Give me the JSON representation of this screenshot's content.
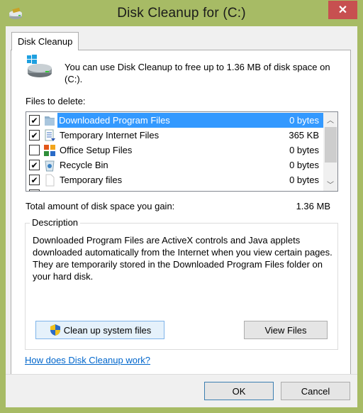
{
  "window": {
    "title": "Disk Cleanup for  (C:)",
    "close_icon": "close-icon",
    "app_icon": "disk-cleanup-icon"
  },
  "tabs": [
    {
      "label": "Disk Cleanup",
      "active": true
    }
  ],
  "intro_text": "You can use Disk Cleanup to free up to 1.36 MB of disk space on (C:).",
  "files_to_delete_label": "Files to delete:",
  "files": [
    {
      "name": "Downloaded Program Files",
      "size": "0 bytes",
      "checked": true,
      "selected": true,
      "icon": "folder-icon"
    },
    {
      "name": "Temporary Internet Files",
      "size": "365 KB",
      "checked": true,
      "selected": false,
      "icon": "document-icon"
    },
    {
      "name": "Office Setup Files",
      "size": "0 bytes",
      "checked": false,
      "selected": false,
      "icon": "office-icon"
    },
    {
      "name": "Recycle Bin",
      "size": "0 bytes",
      "checked": true,
      "selected": false,
      "icon": "recycle-bin-icon"
    },
    {
      "name": "Temporary files",
      "size": "0 bytes",
      "checked": true,
      "selected": false,
      "icon": "file-icon"
    }
  ],
  "total": {
    "label": "Total amount of disk space you gain:",
    "value": "1.36 MB"
  },
  "description": {
    "legend": "Description",
    "text": "Downloaded Program Files are ActiveX controls and Java applets downloaded automatically from the Internet when you view certain pages. They are temporarily stored in the Downloaded Program Files folder on your hard disk."
  },
  "buttons": {
    "cleanup_system": "Clean up system files",
    "view_files": "View Files",
    "ok": "OK",
    "cancel": "Cancel"
  },
  "help_link": "How does Disk Cleanup work?",
  "glyphs": {
    "check": "✔",
    "close": "✕",
    "up": "︿",
    "down": "﹀"
  },
  "colors": {
    "frame": "#a7bb65",
    "close": "#c75050",
    "selection": "#3399ff",
    "link": "#0066cc"
  }
}
